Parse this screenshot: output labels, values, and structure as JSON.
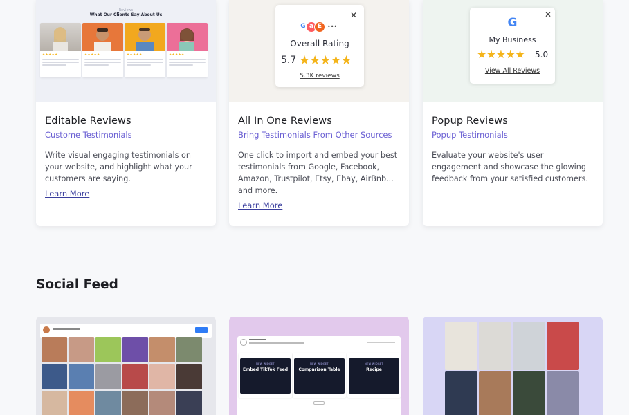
{
  "cards": [
    {
      "title": "Editable Reviews",
      "subtitle": "Custome Testimonials",
      "description": "Write visual engaging testimonials on your website, and highlight what your customers are saying.",
      "link": "Learn More",
      "preview": {
        "label": "Reviews",
        "heading": "What Our Clients Say About Us",
        "stars": "★★★★★"
      }
    },
    {
      "title": "All In One Reviews",
      "subtitle": "Bring Testimonials From Other Sources",
      "description": "One click to import and embed your best testimonials from Google, Facebook, Amazon, Trustpilot, Etsy, Ebay, AirBnb... and more.",
      "link": "Learn More",
      "preview": {
        "heading": "Overall Rating",
        "score": "5.7",
        "stars": "★★★★★",
        "reviews": "5.3K reviews",
        "more": "•••"
      }
    },
    {
      "title": "Popup Reviews",
      "subtitle": "Popup Testimonials",
      "description": "Evaluate your website's user engagement and showcase the glowing feedback from your satisfied customers.",
      "link": "",
      "preview": {
        "logo": "G",
        "name": "My Business",
        "stars": "★★★★★",
        "score": "5.0",
        "link": "View All Reviews"
      }
    }
  ],
  "close_glyph": "✕",
  "social": {
    "title": "Social Feed",
    "widgets": [
      {
        "tag": "NEW WIDGET",
        "title": "Embed TikTok Feed"
      },
      {
        "tag": "NEW WIDGET",
        "title": "Comparison Table"
      },
      {
        "tag": "NEW WIDGET",
        "title": "Recipe"
      }
    ]
  },
  "colors": {
    "accent": "#6a5fd3",
    "link": "#3b3f9e",
    "star": "#f4b41a"
  }
}
